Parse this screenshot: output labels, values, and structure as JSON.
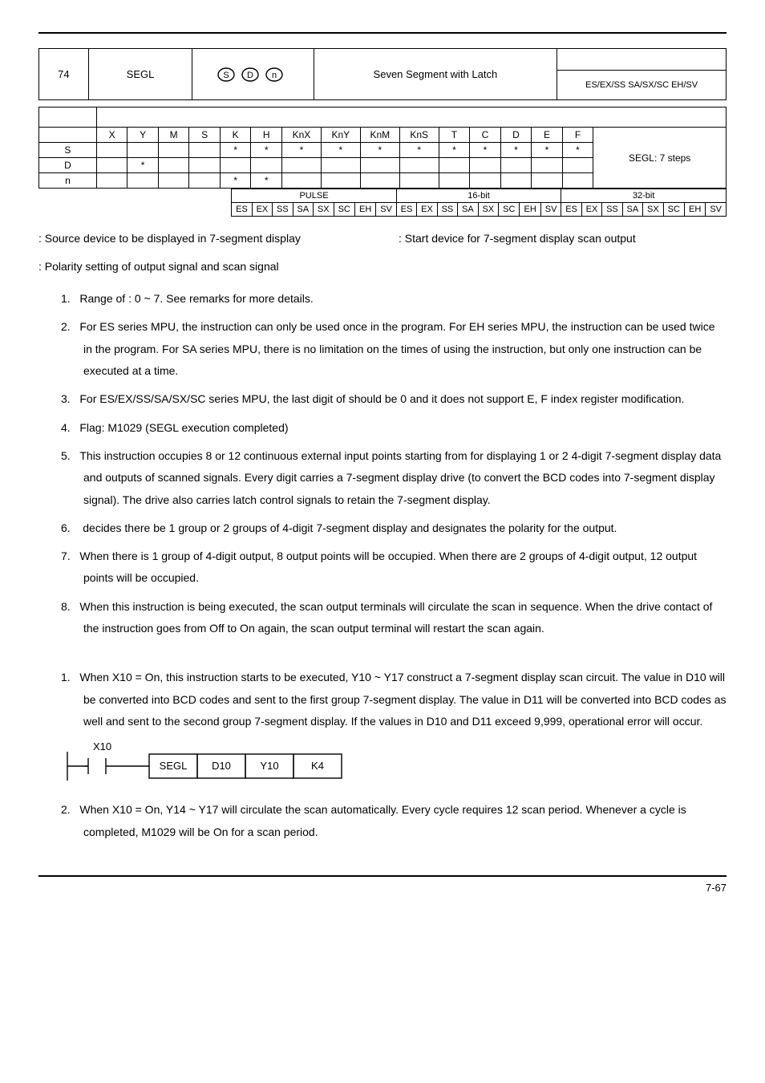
{
  "header": {
    "api_num": "74",
    "name": "SEGL",
    "desc": "Seven Segment with Latch",
    "box_text": "ES/EX/SS SA/SX/SC EH/SV"
  },
  "op_table": {
    "cols": [
      "X",
      "Y",
      "M",
      "S",
      "K",
      "H",
      "KnX",
      "KnY",
      "KnM",
      "KnS",
      "T",
      "C",
      "D",
      "E",
      "F"
    ],
    "rows": [
      {
        "label": "S",
        "cells": [
          "",
          "",
          "",
          "",
          "*",
          "*",
          "*",
          "*",
          "*",
          "*",
          "*",
          "*",
          "*",
          "*",
          "*"
        ]
      },
      {
        "label": "D",
        "cells": [
          "",
          "*",
          "",
          "",
          "",
          "",
          "",
          "",
          "",
          "",
          "",
          "",
          "",
          "",
          ""
        ]
      },
      {
        "label": "n",
        "cells": [
          "",
          "",
          "",
          "",
          "*",
          "*",
          "",
          "",
          "",
          "",
          "",
          "",
          "",
          "",
          ""
        ]
      }
    ],
    "steps": "SEGL: 7 steps"
  },
  "bit_table": {
    "groups": [
      "PULSE",
      "16-bit",
      "32-bit"
    ],
    "cols": [
      "ES",
      "EX",
      "SS",
      "SA",
      "SX",
      "SC",
      "EH",
      "SV",
      "ES",
      "EX",
      "SS",
      "SA",
      "SX",
      "SC",
      "EH",
      "SV",
      "ES",
      "EX",
      "SS",
      "SA",
      "SX",
      "SC",
      "EH",
      "SV"
    ]
  },
  "lines": {
    "src": ": Source device to be displayed in 7-segment display",
    "start": ": Start device for 7-segment display scan output",
    "pol": ": Polarity setting of output signal and scan signal"
  },
  "items": [
    "Range of   : 0 ~ 7. See remarks for more details.",
    "For ES series MPU, the instruction can only be used once in the program. For EH series MPU, the instruction can be used twice in the program. For SA series MPU, there is no limitation on the times of using the instruction, but only one instruction can be executed at a time.",
    "For ES/EX/SS/SA/SX/SC series MPU, the last digit of    should be 0 and it does not support E, F index register modification.",
    "Flag: M1029 (SEGL execution completed)",
    "This instruction occupies 8 or 12 continuous external input points starting from    for displaying 1 or 2 4-digit 7-segment display data and outputs of scanned signals. Every digit carries a 7-segment display drive (to convert the BCD codes into 7-segment display signal). The drive also carries latch control signals to retain the 7-segment display.",
    "   decides there be 1 group or 2 groups of 4-digit 7-segment display and designates the polarity for the output.",
    "When there is 1 group of 4-digit output, 8 output points will be occupied. When there are 2 groups of 4-digit output, 12 output points will be occupied.",
    "When this instruction is being executed, the scan output terminals will circulate the scan in sequence. When the drive contact of the instruction goes from Off to On again, the scan output terminal will restart the scan again."
  ],
  "example": [
    "When X10 = On, this instruction starts to be executed, Y10 ~ Y17 construct a 7-segment display scan circuit. The value in D10 will be converted into BCD codes and sent to the first group 7-segment display. The value in D11 will be converted into BCD codes as well and sent to the second group 7-segment display. If the values in D10 and D11 exceed 9,999, operational error will occur.",
    "When X10 = On, Y14 ~ Y17 will circulate the scan automatically. Every cycle requires 12 scan period. Whenever a cycle is completed, M1029 will be On for a scan period."
  ],
  "ladder": {
    "contact": "X10",
    "inst": "SEGL",
    "op1": "D10",
    "op2": "Y10",
    "op3": "K4"
  },
  "page": "7-67"
}
